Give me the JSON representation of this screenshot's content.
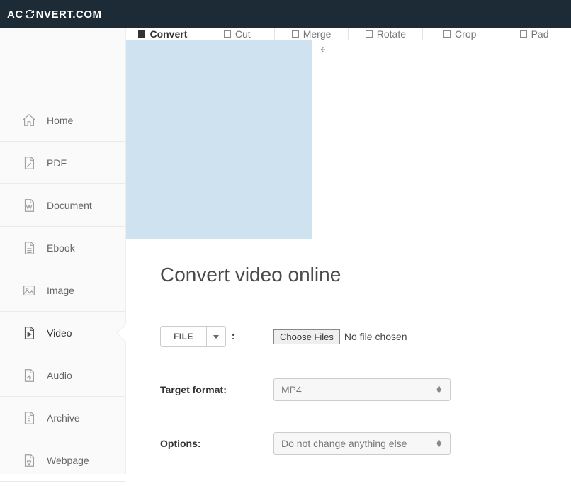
{
  "brand": {
    "pre": "AC",
    "post": "NVERT.COM"
  },
  "sidebar": {
    "items": [
      {
        "label": "Home"
      },
      {
        "label": "PDF"
      },
      {
        "label": "Document"
      },
      {
        "label": "Ebook"
      },
      {
        "label": "Image"
      },
      {
        "label": "Video"
      },
      {
        "label": "Audio"
      },
      {
        "label": "Archive"
      },
      {
        "label": "Webpage"
      }
    ]
  },
  "tabs": [
    {
      "label": "Convert"
    },
    {
      "label": "Cut"
    },
    {
      "label": "Merge"
    },
    {
      "label": "Rotate"
    },
    {
      "label": "Crop"
    },
    {
      "label": "Pad"
    }
  ],
  "page": {
    "heading": "Convert video online",
    "file_button": "FILE",
    "choose_files": "Choose Files",
    "no_file": "No file chosen",
    "target_label": "Target format:",
    "target_value": "MP4",
    "options_label": "Options:",
    "options_value": "Do not change anything else"
  }
}
